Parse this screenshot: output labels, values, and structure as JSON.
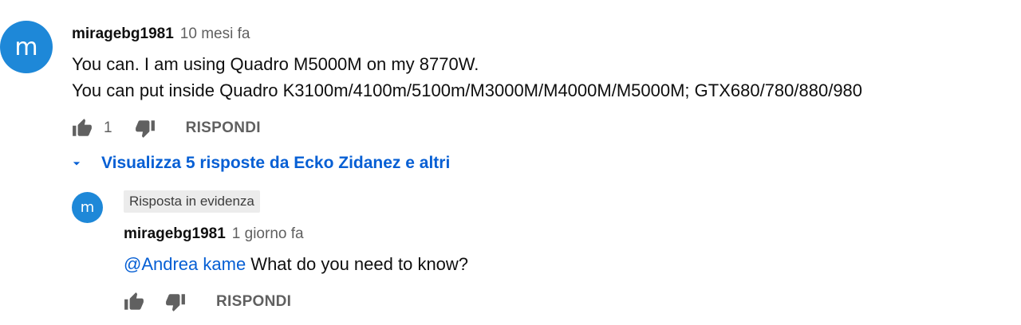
{
  "comment": {
    "avatar_letter": "m",
    "author": "miragebg1981",
    "time": "10 mesi fa",
    "lines": [
      "You can. I am using Quadro M5000M on my 8770W.",
      "You can put inside Quadro K3100m/4100m/5100m/M3000M/M4000M/M5000M; GTX680/780/880/980"
    ],
    "like_count": "1",
    "reply_label": "RISPONDI"
  },
  "view_replies": {
    "label": "Visualizza 5 risposte da Ecko Zidanez e altri"
  },
  "reply": {
    "avatar_letter": "m",
    "badge": "Risposta in evidenza",
    "author": "miragebg1981",
    "time": "1 giorno fa",
    "mention": "@Andrea kame",
    "text": " What do you need to know?",
    "reply_label": "RISPONDI"
  },
  "colors": {
    "avatar": "#1e88d8",
    "link": "#065fd4",
    "secondary_text": "#606060",
    "icon": "#606060"
  },
  "icons": {
    "like": "thumb-up-icon",
    "dislike": "thumb-down-icon",
    "expand": "caret-down-icon"
  }
}
